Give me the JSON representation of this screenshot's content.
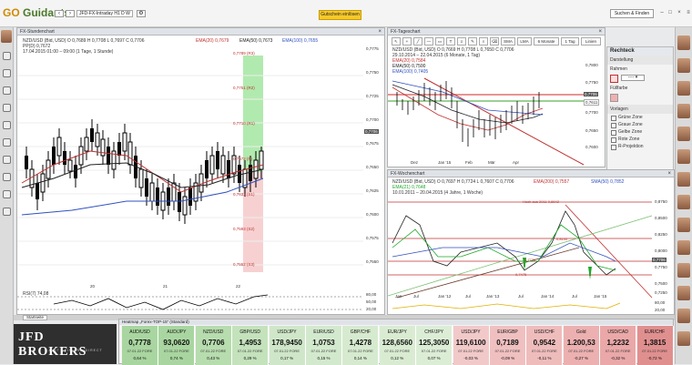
{
  "app": {
    "logo_go": "GO",
    "logo_text": "Guidants",
    "url": "JFD-FX-Intraday H1 D W",
    "cta_button": "Gutschein einlösen",
    "search_button": "Suchen & Finden"
  },
  "chart_left": {
    "title": "FX-Stundenchart",
    "legend_line1": "NZD/USD (Bid, USD)  O 0,7689  H 0,7708  L 0,7697  C 0,7706",
    "legend_ema20": "EMA(20)  0,7679",
    "legend_ema50": "EMA(50)  0,7673",
    "legend_ema100": "EMA(100)  0,7655",
    "legend_line2": "PP(D)  0,7672",
    "legend_line3": "17.04.2015 01:00 – 09:00 (1 Tage, 1 Stunde)",
    "price_labels": [
      "0,7775",
      "0,7750",
      "0,7725",
      "0,7700",
      "0,7675",
      "0,7650",
      "0,7625",
      "0,7600",
      "0,7575",
      "0,7550"
    ],
    "levels": [
      {
        "name": "0,7789 (R3)",
        "color": "#c03030"
      },
      {
        "name": "0,7751 (R2)",
        "color": "#c03030"
      },
      {
        "name": "0,7710 (R1)",
        "color": "#c03030"
      },
      {
        "name": "0,7672 (P)",
        "color": "#c03030"
      },
      {
        "name": "0,7631 (S1)",
        "color": "#c03030"
      },
      {
        "name": "0,7593 (S2)",
        "color": "#c03030"
      },
      {
        "name": "0,7552 (S3)",
        "color": "#c03030"
      }
    ],
    "current_price": "0,7706",
    "x_labels": [
      "20",
      "21",
      "22"
    ],
    "rsi_label": "RSI(7)  74,08",
    "rsi_axis": [
      "80,00",
      "50,00",
      "20,00"
    ]
  },
  "chart_daily": {
    "title": "FX-Tageschart",
    "toolbar": {
      "sma": "SMA",
      "lma": "LMA",
      "period": "6 Monate",
      "interval": "1 Tag",
      "type": "Linien"
    },
    "legend_line1": "NZD/USD (Bid, USD)  O 0,7669  H 0,7708  L 0,7650  C 0,7706",
    "legend_line2": "29.10.2014 – 22.04.2015 (6 Monate, 1 Tag)",
    "legend_ema20": "EMA(20)  0,7584",
    "legend_ema50": "EMA(50)  0,7500",
    "legend_ema100": "EMA(100)  0,7405",
    "price_labels": [
      "0,7800",
      "0,7750",
      "0,7700",
      "0,7650",
      "0,7600",
      "0,7550",
      "0,7500"
    ],
    "tag1": "0,7706",
    "tag2": "0,7611",
    "x_labels": [
      "Dez",
      "Jan '15",
      "Feb",
      "Mär",
      "Apr"
    ]
  },
  "chart_weekly": {
    "title": "FX-Wochenchart",
    "legend_line1": "NZD/USD (Bid, USD)  O 0,7697  H 0,7724  L 0,7607  C 0,7706",
    "legend_ema200": "EMA(200)  0,7557",
    "legend_sma50": "SMA(50)  0,7852",
    "legend_line2": "10.01.2011 – 20.04.2015 (4 Jahre, 1 Woche)",
    "legend_ema21": "EMA(21)  0,7648",
    "annotation_hoch": "Hoch aus 2011 0,8842",
    "annotation_a": "0,8100",
    "annotation_b": "0,7776",
    "annotation_c": "0,7475",
    "price_labels": [
      "0,8750",
      "0,8500",
      "0,8250",
      "0,8000",
      "0,7750",
      "0,7500",
      "0,7250"
    ],
    "tag": "0,7706",
    "x_labels": [
      "Jan",
      "Jul",
      "Jan '12",
      "Jul",
      "Jan '13",
      "Jul",
      "Jan '14",
      "Jul",
      "Jan '15"
    ],
    "oscillator_axis": [
      "80,00",
      "20,00"
    ]
  },
  "sidebar_right": {
    "title": "Rechteck",
    "rahmen_label": "Darstellung",
    "rahmen": "Rahmen",
    "fuellfarbe": "Füllfarbe",
    "vorlagen": "Vorlagen",
    "items": [
      "Grüne Zone",
      "Graue Zone",
      "Gelbe Zone",
      "Rote Zone",
      "R-Projektion"
    ]
  },
  "heatmap": {
    "tab": "Startseite",
    "title": "Heatmap „Forex-TOP-15“ (Standard)",
    "cells": [
      {
        "name": "AUD/USD",
        "value": "0,7778",
        "sub": "07.01.22 FORE",
        "pct": "0,64 %",
        "color": "#a9d6a0"
      },
      {
        "name": "AUD/JPY",
        "value": "93,0620",
        "sub": "07.01.22 FORE",
        "pct": "0,74 %",
        "color": "#a9d6a0"
      },
      {
        "name": "NZD/USD",
        "value": "0,7706",
        "sub": "07.01.22 FORE",
        "pct": "0,43 %",
        "color": "#b7dcae"
      },
      {
        "name": "GBP/USD",
        "value": "1,4953",
        "sub": "07.01.22 FORE",
        "pct": "0,29 %",
        "color": "#c4e2bc"
      },
      {
        "name": "USD/JPY",
        "value": "178,9450",
        "sub": "07.01.22 FORE",
        "pct": "0,17 %",
        "color": "#cfe7c8"
      },
      {
        "name": "EUR/USD",
        "value": "1,0753",
        "sub": "07.01.22 FORE",
        "pct": "0,15 %",
        "color": "#d3e9cd"
      },
      {
        "name": "GBP/CHF",
        "value": "1,4278",
        "sub": "07.01.22 FORE",
        "pct": "0,14 %",
        "color": "#d6eacf"
      },
      {
        "name": "EUR/JPY",
        "value": "128,6560",
        "sub": "07.01.22 FORE",
        "pct": "0,12 %",
        "color": "#d9ecd2"
      },
      {
        "name": "CHF/JPY",
        "value": "125,3050",
        "sub": "07.01.22 FORE",
        "pct": "0,07 %",
        "color": "#dcedd6"
      },
      {
        "name": "USD/JPY",
        "value": "119,6100",
        "sub": "07.01.22 FORE",
        "pct": "-0,03 %",
        "color": "#f2c9c9"
      },
      {
        "name": "EUR/GBP",
        "value": "0,7189",
        "sub": "07.01.22 FORE",
        "pct": "-0,09 %",
        "color": "#f0c0c0"
      },
      {
        "name": "USD/CHF",
        "value": "0,9542",
        "sub": "07.01.22 FORE",
        "pct": "-0,11 %",
        "color": "#efbcbc"
      },
      {
        "name": "Gold",
        "value": "1.200,53",
        "sub": "07.01.22 FORE",
        "pct": "-0,27 %",
        "color": "#ecb0b0"
      },
      {
        "name": "USD/CAD",
        "value": "1,2232",
        "sub": "07.01.22 FORE",
        "pct": "-0,32 %",
        "color": "#eaa8a8"
      },
      {
        "name": "EUR/CHF",
        "value": "1,3815",
        "sub": "07.01.22 FORE",
        "pct": "-0,72 %",
        "color": "#e08f8f"
      }
    ]
  },
  "broker": {
    "name": "JFD BROKERS",
    "tagline": "JUST FAIR AND DIRECT"
  },
  "colors": {
    "ema_red": "#c03030",
    "ema_black": "#222222",
    "ema_blue": "#3050c0",
    "zone_green": "#8fe08a",
    "zone_red": "#f2b8b8",
    "up_arrow": "#1fa82a"
  }
}
